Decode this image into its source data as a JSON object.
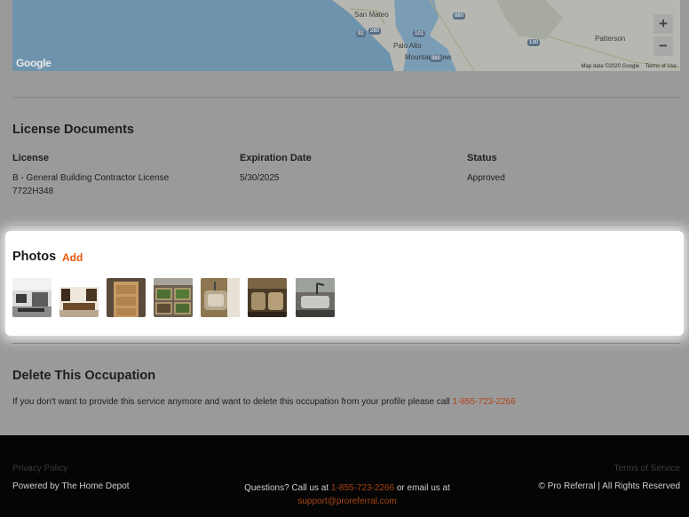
{
  "map": {
    "cities": [
      "San Mateo",
      "Palo Alto",
      "Mountain View",
      "Patterson"
    ],
    "highway_shields": [
      "92",
      "280",
      "880",
      "101",
      "130",
      "880"
    ],
    "google_logo": "Google",
    "map_data": "Map data ©2020 Google",
    "terms": "Terms of Use",
    "zoom_in": "+",
    "zoom_out": "−"
  },
  "license": {
    "section_title": "License Documents",
    "headers": {
      "license": "License",
      "expiration": "Expiration Date",
      "status": "Status"
    },
    "rows": [
      {
        "license_line1": "B - General Building Contractor License",
        "license_line2": "7722H348",
        "expiration": "5/30/2025",
        "status": "Approved"
      }
    ]
  },
  "photos": {
    "title": "Photos",
    "add_label": "Add",
    "thumbnails": [
      "kitchen-photo",
      "kitchen-island-photo",
      "cabinet-photo",
      "garden-beds-photo",
      "sink-photo",
      "double-sink-photo",
      "faucet-photo"
    ]
  },
  "delete": {
    "title": "Delete This Occupation",
    "message": "If you don't want to provide this service anymore and want to delete this occupation from your profile please call",
    "phone": "1-855-723-2266"
  },
  "footer": {
    "privacy": "Privacy Policy",
    "terms": "Terms of Service",
    "powered_by": "Powered by The Home Depot",
    "questions_prefix": "Questions? Call us at",
    "phone": "1-855-723-2266",
    "email_prefix": "or email us at",
    "email": "support@proreferral.com",
    "copyright": "© Pro Referral | All Rights Reserved"
  },
  "colors": {
    "accent_orange": "#e8580c",
    "page_dimmed": "#9a9a9a",
    "footer_bg": "#050505"
  }
}
